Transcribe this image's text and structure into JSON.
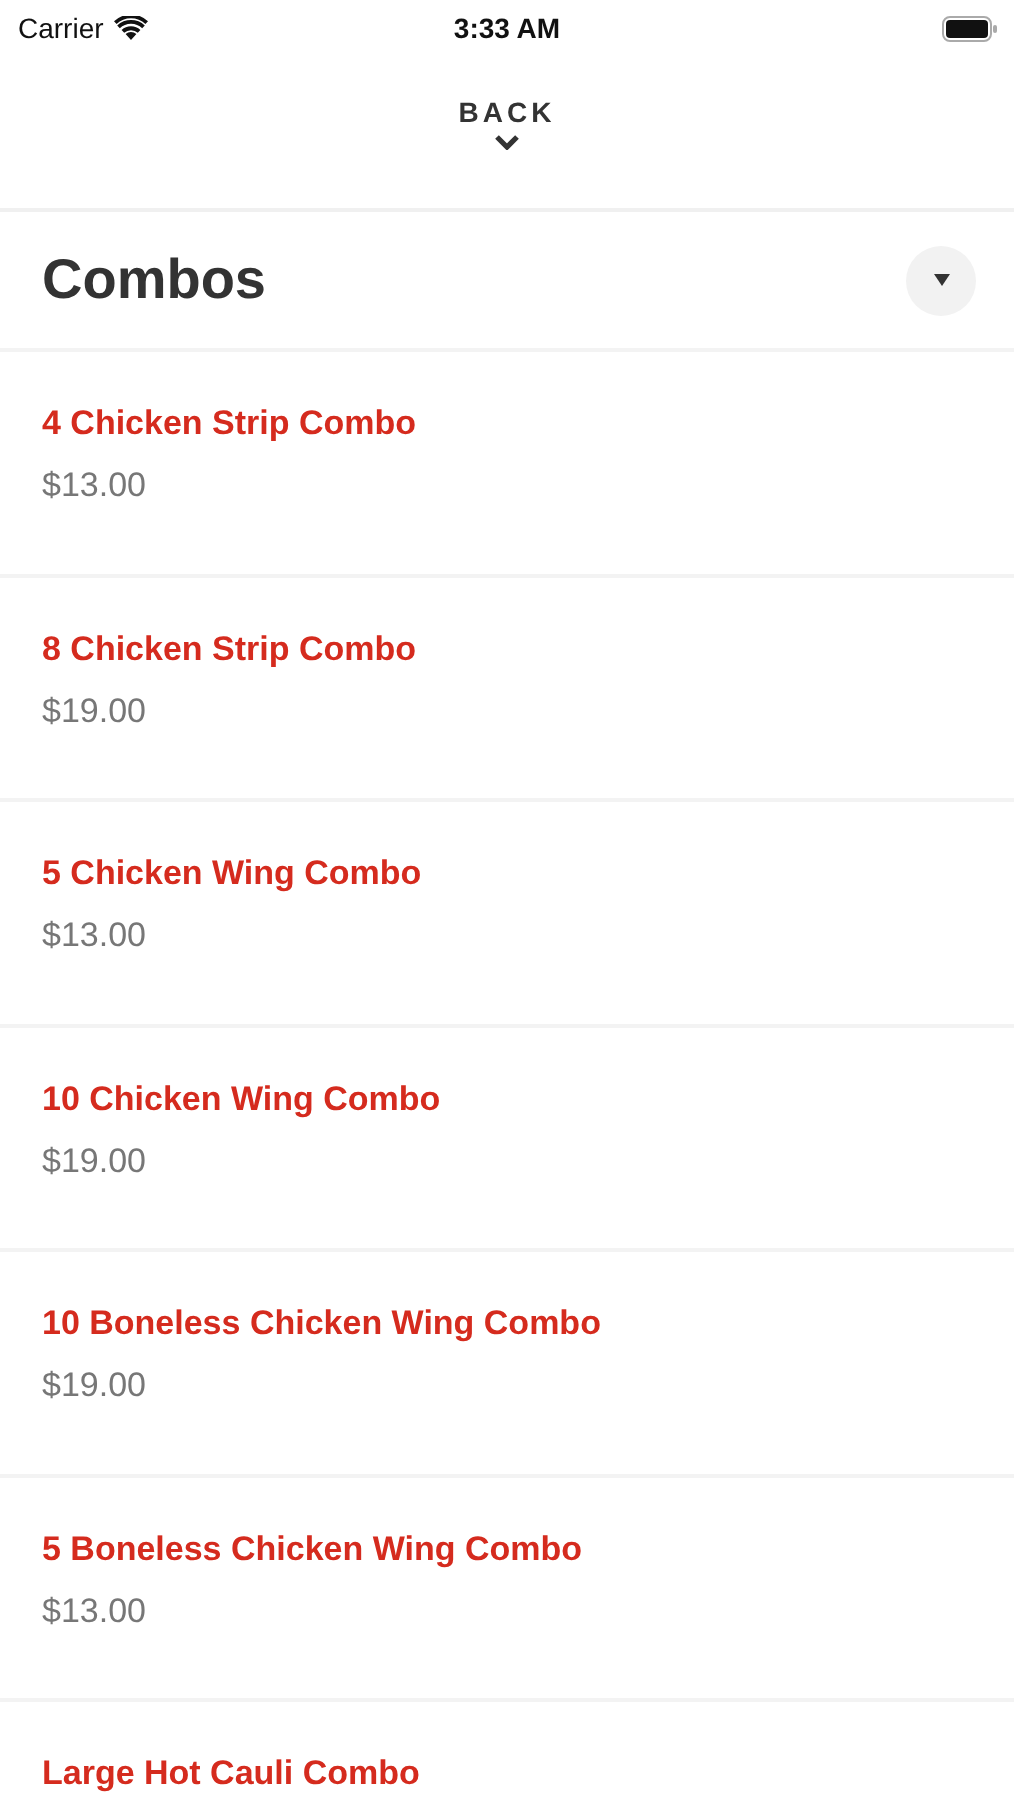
{
  "status_bar": {
    "carrier": "Carrier",
    "time": "3:33 AM"
  },
  "back": {
    "label": "BACK"
  },
  "section": {
    "title": "Combos"
  },
  "items": [
    {
      "name": "4 Chicken Strip Combo",
      "price": "$13.00"
    },
    {
      "name": "8 Chicken Strip Combo",
      "price": "$19.00"
    },
    {
      "name": "5 Chicken Wing Combo",
      "price": "$13.00"
    },
    {
      "name": "10 Chicken Wing Combo",
      "price": "$19.00"
    },
    {
      "name": "10 Boneless Chicken Wing Combo",
      "price": "$19.00"
    },
    {
      "name": "5 Boneless Chicken Wing Combo",
      "price": "$13.00"
    },
    {
      "name": "Large Hot Cauli Combo"
    }
  ]
}
